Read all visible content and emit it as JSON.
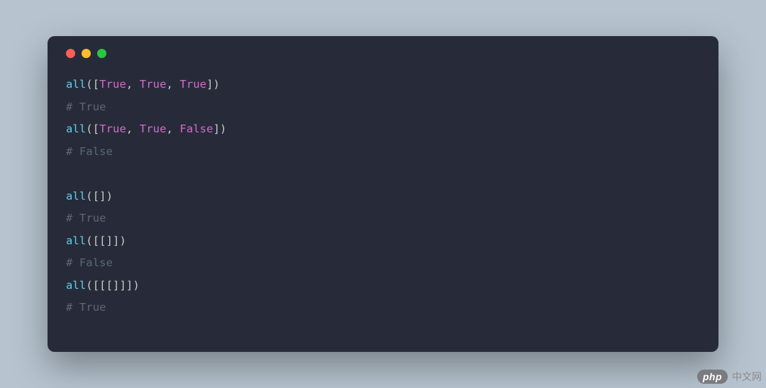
{
  "window": {
    "dots": [
      "red",
      "yellow",
      "green"
    ]
  },
  "colors": {
    "bg_page": "#b7c4cf",
    "bg_window": "#272b39",
    "fn": "#5ccfe6",
    "keyword": "#d36cc9",
    "bracket": "#cbccc6",
    "comment": "#5c6773"
  },
  "code_lines": [
    {
      "type": "code",
      "tokens": [
        {
          "cls": "fn",
          "text": "all"
        },
        {
          "cls": "bracket",
          "text": "(["
        },
        {
          "cls": "kw",
          "text": "True"
        },
        {
          "cls": "comma",
          "text": ", "
        },
        {
          "cls": "kw",
          "text": "True"
        },
        {
          "cls": "comma",
          "text": ", "
        },
        {
          "cls": "kw",
          "text": "True"
        },
        {
          "cls": "bracket",
          "text": "])"
        }
      ]
    },
    {
      "type": "comment",
      "text": "# True"
    },
    {
      "type": "code",
      "tokens": [
        {
          "cls": "fn",
          "text": "all"
        },
        {
          "cls": "bracket",
          "text": "(["
        },
        {
          "cls": "kw",
          "text": "True"
        },
        {
          "cls": "comma",
          "text": ", "
        },
        {
          "cls": "kw",
          "text": "True"
        },
        {
          "cls": "comma",
          "text": ", "
        },
        {
          "cls": "kw",
          "text": "False"
        },
        {
          "cls": "bracket",
          "text": "])"
        }
      ]
    },
    {
      "type": "comment",
      "text": "# False"
    },
    {
      "type": "blank"
    },
    {
      "type": "code",
      "tokens": [
        {
          "cls": "fn",
          "text": "all"
        },
        {
          "cls": "bracket",
          "text": "([])"
        }
      ]
    },
    {
      "type": "comment",
      "text": "# True"
    },
    {
      "type": "code",
      "tokens": [
        {
          "cls": "fn",
          "text": "all"
        },
        {
          "cls": "bracket",
          "text": "([[]])"
        }
      ]
    },
    {
      "type": "comment",
      "text": "# False"
    },
    {
      "type": "code",
      "tokens": [
        {
          "cls": "fn",
          "text": "all"
        },
        {
          "cls": "bracket",
          "text": "([[[]]])"
        }
      ]
    },
    {
      "type": "comment",
      "text": "# True"
    }
  ],
  "watermark": {
    "badge": "php",
    "text": "中文网"
  }
}
